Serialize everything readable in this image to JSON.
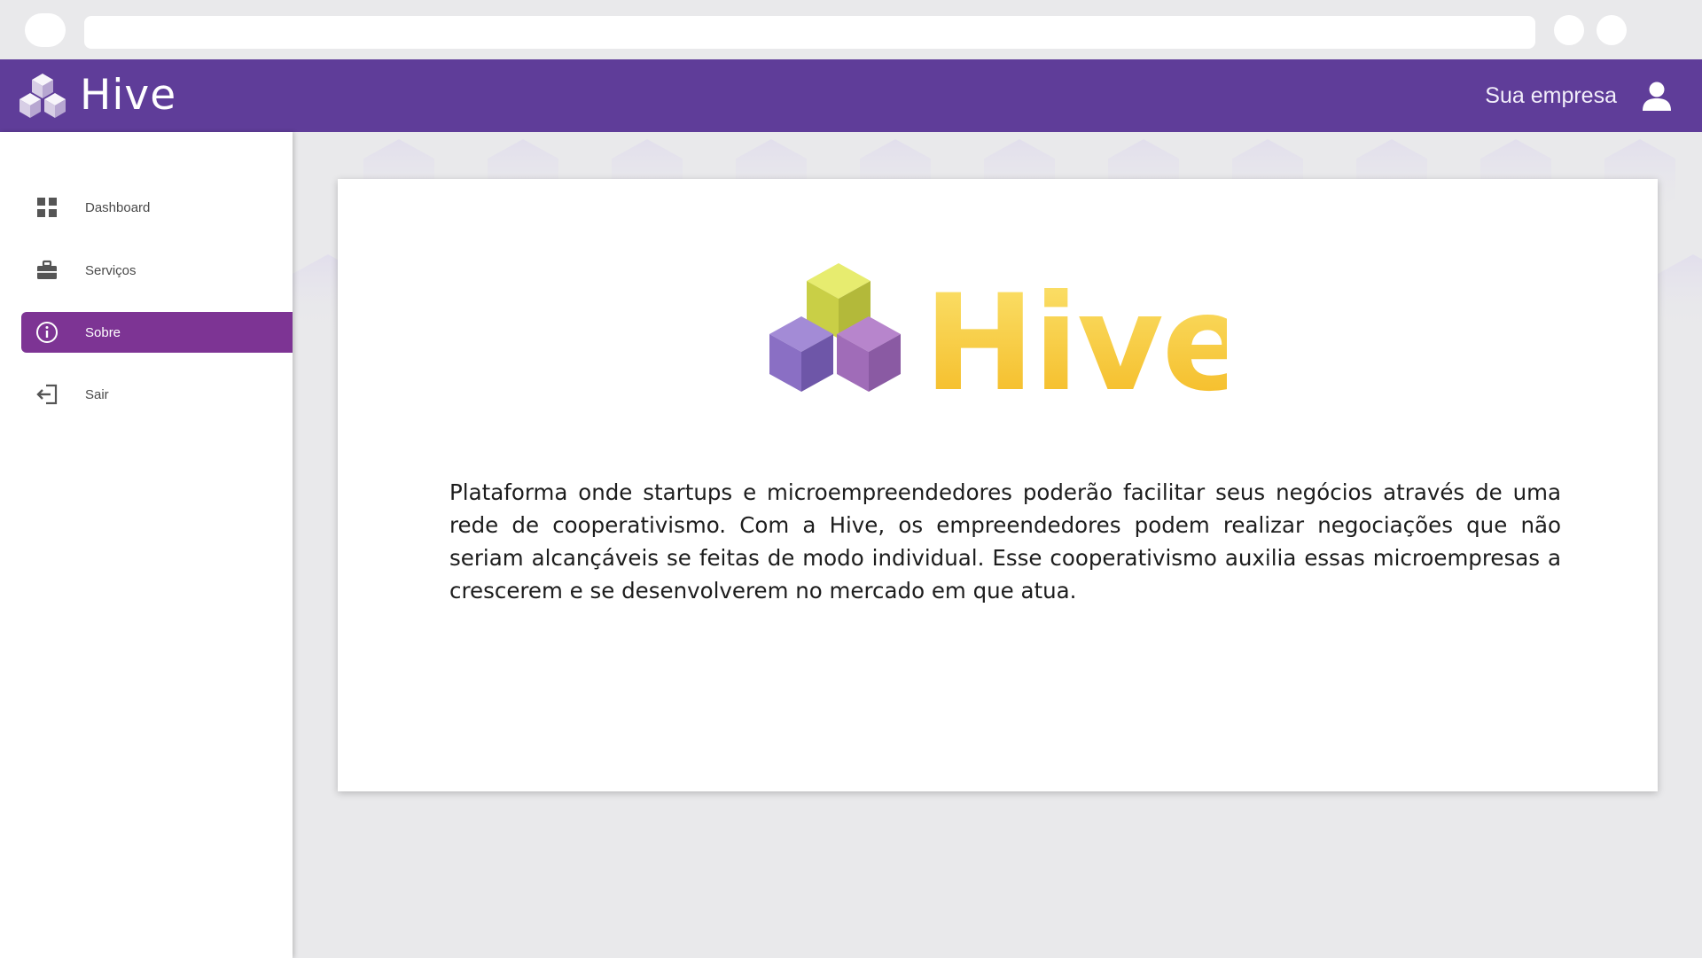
{
  "app": {
    "name": "Hive",
    "company_label": "Sua empresa"
  },
  "sidebar": {
    "items": [
      {
        "label": "Dashboard",
        "icon": "grid-icon",
        "active": false
      },
      {
        "label": "Serviços",
        "icon": "briefcase-icon",
        "active": false
      },
      {
        "label": "Sobre",
        "icon": "info-icon",
        "active": true
      },
      {
        "label": "Sair",
        "icon": "logout-icon",
        "active": false
      }
    ]
  },
  "main": {
    "logo_text": "Hive",
    "about": "Plataforma onde startups e microempreendedores poderão facilitar seus negócios através de uma rede de cooperativismo. Com a Hive, os empreendedores podem realizar negociações que não seriam alcançáveis se feitas de modo individual. Esse cooperativismo auxilia essas microempresas a crescerem e se desenvolverem no mercado em que atua."
  },
  "colors": {
    "header": "#5f3d99",
    "active_nav": "#7d3494",
    "logo_yellow": "#f7c531",
    "cube_purple": "#8a6fc4",
    "cube_pink": "#a06cb8",
    "cube_yellow": "#d7dc5a",
    "background": "#e9e9eb"
  }
}
